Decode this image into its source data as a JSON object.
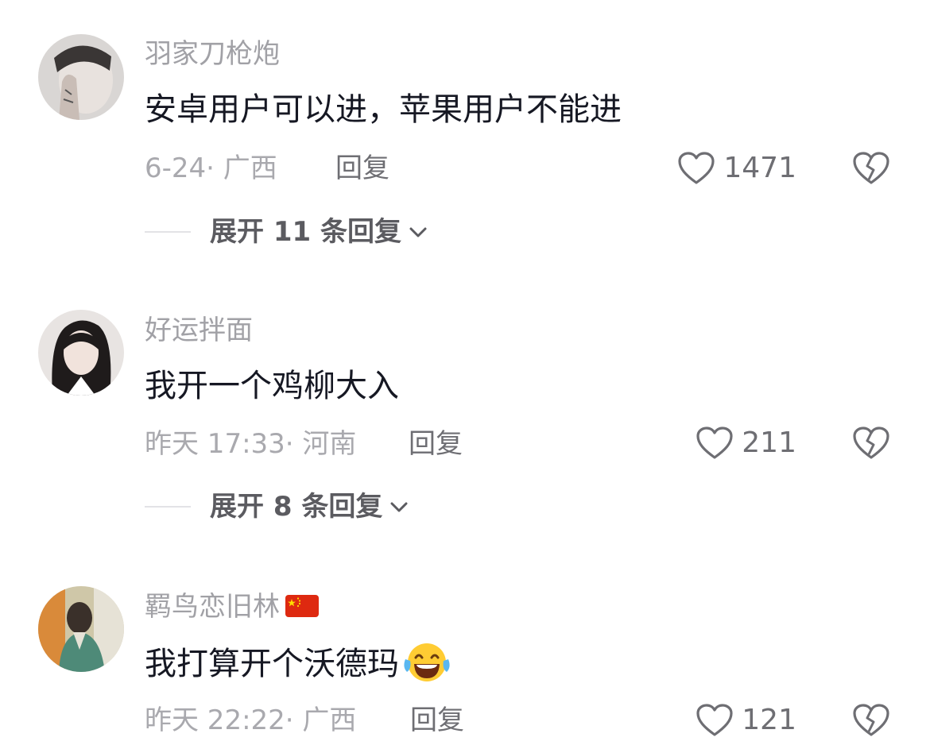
{
  "comments": [
    {
      "username": "羽家刀枪炮",
      "text": "安卓用户可以进，苹果用户不能进",
      "meta": "6-24· 广西",
      "reply_label": "回复",
      "likes": "1471",
      "expand_label": "展开 11 条回复"
    },
    {
      "username": "好运拌面",
      "text": "我开一个鸡柳大入",
      "meta": "昨天 17:33· 河南",
      "reply_label": "回复",
      "likes": "211",
      "expand_label": "展开 8 条回复"
    },
    {
      "username": "羁鸟恋旧林",
      "text": "我打算开个沃德玛",
      "meta": "昨天 22:22· 广西",
      "reply_label": "回复",
      "likes": "121",
      "username_emoji": "china-flag",
      "text_emoji": "tears-of-joy-emoji"
    }
  ],
  "colors": {
    "username": "#a1a1a6",
    "text": "#161823",
    "meta": "#a9a9ae",
    "action": "#6e6e73"
  }
}
